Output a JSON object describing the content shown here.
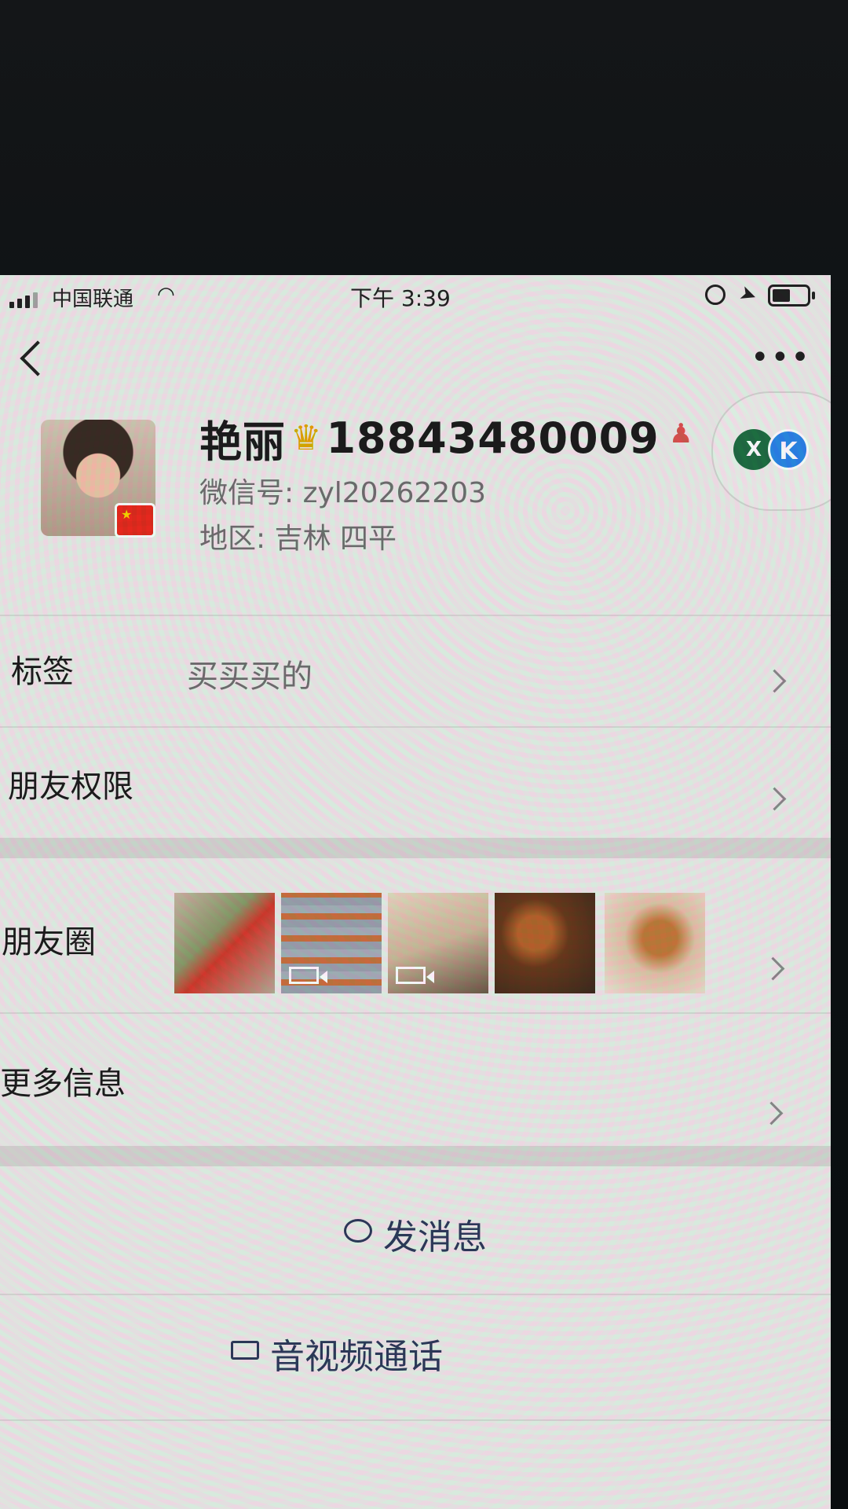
{
  "status_bar": {
    "carrier": "中国联通",
    "time": "下午 3:39"
  },
  "profile": {
    "name": "艳丽",
    "phone": "18843480009",
    "wechat_id": "微信号: zyl20262203",
    "region": "地区: 吉林 四平"
  },
  "badges": {
    "x_label": "X"
  },
  "rows": {
    "tags_label": "标签",
    "tags_value": "买买买的",
    "permissions_label": "朋友权限",
    "moments_label": "朋友圈",
    "more_info_label": "更多信息"
  },
  "moments_thumbs": [
    {
      "kind": "photo"
    },
    {
      "kind": "video"
    },
    {
      "kind": "video"
    },
    {
      "kind": "photo"
    },
    {
      "kind": "photo"
    }
  ],
  "actions": {
    "send_message": "发消息",
    "video_call": "音视频通话"
  },
  "icons": {
    "back": "back-arrow-icon",
    "more": "more-dots-icon",
    "crown": "crown-icon",
    "person": "person-icon",
    "message": "chat-bubble-icon",
    "video": "video-camera-icon"
  },
  "colors": {
    "action_text": "#2d3a5a",
    "badge_green": "#1f6e43",
    "badge_blue": "#2a86e6"
  }
}
